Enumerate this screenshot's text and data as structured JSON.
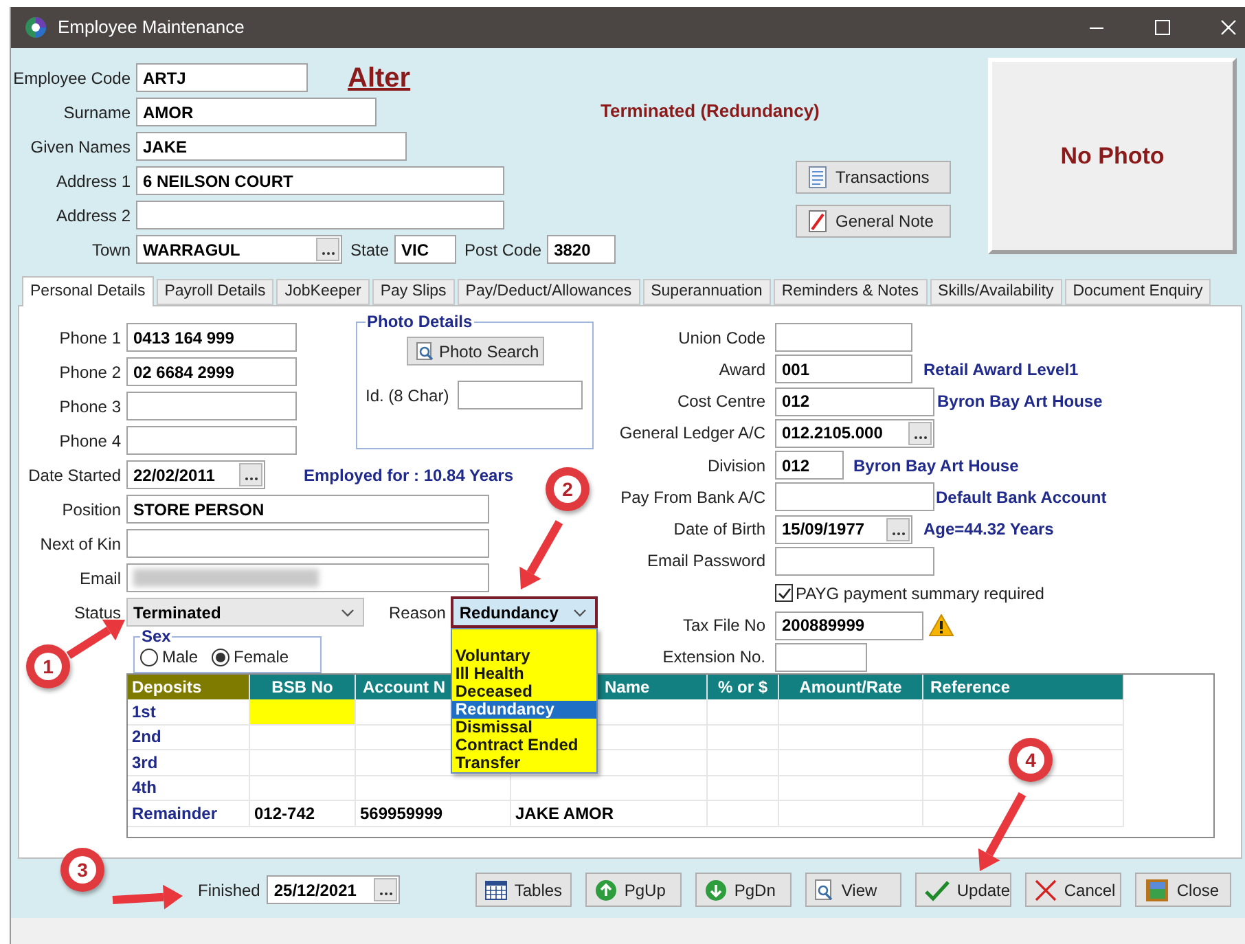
{
  "window": {
    "title": "Employee Maintenance"
  },
  "header": {
    "mode": "Alter",
    "status_text": "Terminated (Redundancy)",
    "fields": [
      {
        "label": "Employee Code",
        "value": "ARTJ"
      },
      {
        "label": "Surname",
        "value": "AMOR"
      },
      {
        "label": "Given Names",
        "value": "JAKE"
      },
      {
        "label": "Address 1",
        "value": "6 NEILSON COURT"
      },
      {
        "label": "Address 2"
      }
    ],
    "location": [
      {
        "kind": "lookup",
        "label": "Town",
        "value": "WARRAGUL"
      },
      {
        "kind": "text",
        "label": "State",
        "value": "VIC"
      },
      {
        "kind": "text",
        "label": "Post Code",
        "value": "3820"
      }
    ],
    "buttons": [
      {
        "kind": "transactions",
        "label": "Transactions"
      },
      {
        "kind": "note",
        "label": "General Note"
      }
    ],
    "photo": {
      "text": "No Photo"
    }
  },
  "tabs": [
    {
      "label": "Personal Details",
      "selected": true
    },
    {
      "label": "Payroll Details",
      "selected": false
    },
    {
      "label": "JobKeeper",
      "selected": false
    },
    {
      "label": "Pay Slips",
      "selected": false
    },
    {
      "label": "Pay/Deduct/Allowances",
      "selected": false
    },
    {
      "label": "Superannuation",
      "selected": false
    },
    {
      "label": "Reminders & Notes",
      "selected": false
    },
    {
      "label": "Skills/Availability",
      "selected": false
    },
    {
      "label": "Document Enquiry",
      "selected": false
    }
  ],
  "personal": {
    "phones": [
      {
        "label": "Phone 1",
        "value": "0413 164 999"
      },
      {
        "label": "Phone 2",
        "value": "02 6684 2999"
      },
      {
        "label": "Phone 3"
      },
      {
        "label": "Phone 4"
      }
    ],
    "photo_details": {
      "title": "Photo Details",
      "button": "Photo Search",
      "id_label": "Id. (8 Char)"
    },
    "date_started": {
      "label": "Date Started",
      "value": "22/02/2011",
      "note": "Employed for : 10.84 Years"
    },
    "lines": [
      {
        "label": "Position",
        "value": "STORE PERSON"
      },
      {
        "label": "Next of Kin"
      },
      {
        "label": "Email",
        "blurred": true
      }
    ],
    "status": {
      "label": "Status",
      "value": "Terminated"
    },
    "reason": {
      "label": "Reason",
      "value": "Redundancy",
      "open": true,
      "options": [
        {
          "label": "Voluntary",
          "selected": false
        },
        {
          "label": "Ill Health",
          "selected": false
        },
        {
          "label": "Deceased",
          "selected": false
        },
        {
          "label": "Redundancy",
          "selected": true
        },
        {
          "label": "Dismissal",
          "selected": false
        },
        {
          "label": "Contract Ended",
          "selected": false
        },
        {
          "label": "Transfer",
          "selected": false
        }
      ]
    },
    "sex": {
      "title": "Sex",
      "options": [
        {
          "label": "Male",
          "selected": false
        },
        {
          "label": "Female",
          "selected": true
        }
      ]
    }
  },
  "right_fields": [
    {
      "kind": "text",
      "label": "Union Code"
    },
    {
      "kind": "text",
      "label": "Award",
      "value": "001",
      "note": "Retail Award Level1"
    },
    {
      "kind": "text",
      "label": "Cost Centre",
      "value": "012",
      "note": "Byron Bay Art House"
    },
    {
      "kind": "lookup",
      "label": "General Ledger A/C",
      "value": "012.2105.000"
    },
    {
      "kind": "text",
      "label": "Division",
      "value": "012",
      "note": "Byron Bay Art House"
    },
    {
      "kind": "text",
      "label": "Pay From Bank A/C",
      "note": "Default Bank Account"
    },
    {
      "kind": "lookup",
      "label": "Date of Birth",
      "value": "15/09/1977",
      "note": "Age=44.32 Years"
    },
    {
      "kind": "text",
      "label": "Email Password"
    },
    {
      "kind": "checkbox",
      "label": "PAYG payment summary required",
      "checked": true
    },
    {
      "kind": "text",
      "label": "Tax File No",
      "value": "200889999",
      "warning": true
    },
    {
      "kind": "text",
      "label": "Extension No."
    }
  ],
  "deposits": {
    "columns": [
      "Deposits",
      "BSB No",
      "Account N",
      "Name",
      "% or $",
      "Amount/Rate",
      "Reference"
    ],
    "rows": [
      {
        "label": "1st",
        "selected": true
      },
      {
        "label": "2nd",
        "selected": false
      },
      {
        "label": "3rd",
        "selected": false
      },
      {
        "label": "4th",
        "selected": false
      },
      {
        "label": "Remainder",
        "selected": false,
        "bsb": "012-742",
        "account_no": "569959999",
        "account_name": "JAKE AMOR"
      }
    ]
  },
  "footer": {
    "finished": {
      "label": "Finished",
      "value": "25/12/2021"
    },
    "buttons": [
      {
        "kind": "tables",
        "label": "Tables"
      },
      {
        "kind": "up",
        "label": "PgUp"
      },
      {
        "kind": "down",
        "label": "PgDn"
      },
      {
        "kind": "view",
        "label": "View"
      },
      {
        "kind": "update",
        "label": "Update"
      },
      {
        "kind": "cancel",
        "label": "Cancel"
      },
      {
        "kind": "close",
        "label": "Close"
      }
    ]
  },
  "callouts": [
    {
      "number": "1"
    },
    {
      "number": "2"
    },
    {
      "number": "3"
    },
    {
      "number": "4"
    }
  ]
}
